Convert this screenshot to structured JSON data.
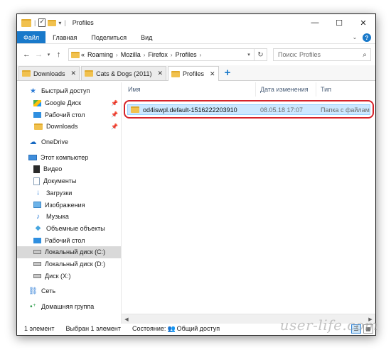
{
  "window": {
    "title": "Profiles"
  },
  "ribbon": {
    "tabs": [
      "Файл",
      "Главная",
      "Поделиться",
      "Вид"
    ]
  },
  "address": {
    "overflow": "«",
    "segments": [
      "Roaming",
      "Mozilla",
      "Firefox",
      "Profiles"
    ]
  },
  "search": {
    "placeholder": "Поиск: Profiles"
  },
  "folder_tabs": [
    {
      "label": "Downloads",
      "active": false
    },
    {
      "label": "Cats & Dogs (2011)",
      "active": false
    },
    {
      "label": "Profiles",
      "active": true
    }
  ],
  "sidebar": {
    "items": [
      {
        "label": "Быстрый доступ",
        "icon": "star-icon",
        "level": 0
      },
      {
        "label": "Google Диск",
        "icon": "google-drive-icon",
        "level": 1,
        "pinned": true
      },
      {
        "label": "Рабочий стол",
        "icon": "desktop-icon",
        "level": 1,
        "pinned": true
      },
      {
        "label": "Downloads",
        "icon": "folder-icon",
        "level": 1,
        "pinned": true
      },
      {
        "label": "OneDrive",
        "icon": "cloud-icon",
        "level": 0
      },
      {
        "label": "Этот компьютер",
        "icon": "computer-icon",
        "level": 0
      },
      {
        "label": "Видео",
        "icon": "video-icon",
        "level": 1
      },
      {
        "label": "Документы",
        "icon": "documents-icon",
        "level": 1
      },
      {
        "label": "Загрузки",
        "icon": "download-arrow-icon",
        "level": 1
      },
      {
        "label": "Изображения",
        "icon": "pictures-icon",
        "level": 1
      },
      {
        "label": "Музыка",
        "icon": "music-icon",
        "level": 1
      },
      {
        "label": "Объемные объекты",
        "icon": "3d-objects-icon",
        "level": 1
      },
      {
        "label": "Рабочий стол",
        "icon": "desktop-icon",
        "level": 1
      },
      {
        "label": "Локальный диск (C:)",
        "icon": "drive-icon",
        "level": 1,
        "selected": true
      },
      {
        "label": "Локальный диск (D:)",
        "icon": "drive-icon",
        "level": 1
      },
      {
        "label": "Диск (X:)",
        "icon": "drive-icon",
        "level": 1
      },
      {
        "label": "Сеть",
        "icon": "network-icon",
        "level": 0
      },
      {
        "label": "Домашняя группа",
        "icon": "homegroup-icon",
        "level": 0
      }
    ]
  },
  "columns": {
    "name": "Имя",
    "date": "Дата изменения",
    "type": "Тип"
  },
  "files": [
    {
      "name": "od4iswpl.default-1516222203910",
      "date": "08.05.18 17:07",
      "type": "Папка с файлами"
    }
  ],
  "status": {
    "count": "1 элемент",
    "selected": "Выбран 1 элемент",
    "state_label": "Состояние:",
    "state_value": "Общий доступ"
  },
  "watermark": "user-life.com",
  "colors": {
    "accent": "#1979ca",
    "selection": "#cce8ff",
    "highlight": "#d6232a"
  }
}
